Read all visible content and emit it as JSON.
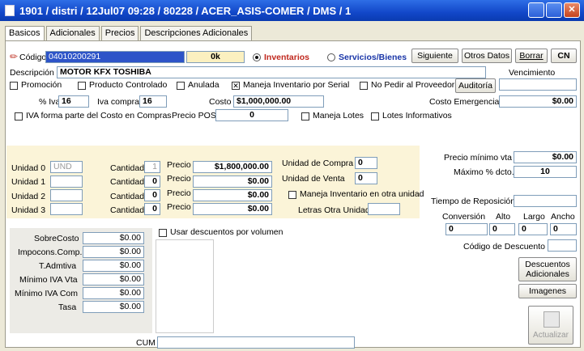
{
  "window": {
    "title": "1901 / distri / 12Jul07 09:28 / 80228 / ACER_ASIS-COMER / DMS / 1"
  },
  "tabs": [
    "Basicos",
    "Adicionales",
    "Precios",
    "Descripciones Adicionales"
  ],
  "header": {
    "codigo_label": "Código",
    "codigo_value": "04010200291",
    "ok_label": "0k",
    "inventarios_label": "Inventarios",
    "servicios_label": "Servicios/Bienes",
    "siguiente": "Siguiente",
    "otros_datos": "Otros Datos",
    "borrar": "Borrar",
    "cn": "CN",
    "descripcion_label": "Descripción",
    "descripcion_value": "MOTOR KFX TOSHIBA",
    "vencimiento_label": "Vencimiento",
    "auditoria": "Auditoría"
  },
  "flags": {
    "promocion": "Promoción",
    "controlado": "Producto Controlado",
    "anulada": "Anulada",
    "serial": "Maneja Inventario por Serial",
    "no_pedir": "No Pedir al Proveedor",
    "iva_costo": "IVA forma parte del Costo en Compras",
    "maneja_lotes": "Maneja Lotes",
    "lotes_info": "Lotes Informativos",
    "otra_unidad": "Maneja Inventario en otra unidad",
    "usar_desc": "Usar descuentos por volumen"
  },
  "tax": {
    "iva_label": "% Iva",
    "iva_value": "16",
    "iva_compra_label": "Iva compra",
    "iva_compra_value": "16",
    "costo_label": "Costo",
    "costo_value": "$1,000,000.00",
    "costo_emerg_label": "Costo Emergencia",
    "costo_emerg_value": "$0.00",
    "precio_pos_label": "Precio POS",
    "precio_pos_value": "0"
  },
  "units": [
    {
      "label": "Unidad 0",
      "unit": "UND",
      "qty": "1",
      "price": "$1,800,000.00"
    },
    {
      "label": "Unidad 1",
      "unit": "",
      "qty": "0",
      "price": "$0.00"
    },
    {
      "label": "Unidad 2",
      "unit": "",
      "qty": "0",
      "price": "$0.00"
    },
    {
      "label": "Unidad 3",
      "unit": "",
      "qty": "0",
      "price": "$0.00"
    }
  ],
  "unit_labels": {
    "cantidad": "Cantidad",
    "precio": "Precio",
    "unidad_compra": "Unidad de Compra",
    "unidad_compra_value": "0",
    "unidad_venta": "Unidad de Venta",
    "unidad_venta_value": "0",
    "letras": "Letras Otra Unidad"
  },
  "right": {
    "precio_min_label": "Precio mínimo vta",
    "precio_min_value": "$0.00",
    "max_dcto_label": "Máximo % dcto.",
    "max_dcto_value": "10",
    "tiempo_label": "Tiempo de Reposición",
    "conversion": "Conversión",
    "alto": "Alto",
    "largo": "Largo",
    "ancho": "Ancho",
    "conv_vals": [
      "0",
      "0",
      "0",
      "0"
    ],
    "cod_desc_label": "Código de Descuento",
    "desc_adic": "Descuentos Adicionales",
    "imagenes": "Imagenes",
    "actualizar": "Actualizar"
  },
  "costs": [
    {
      "label": "SobreCosto",
      "value": "$0.00"
    },
    {
      "label": "Impocons.Comp.",
      "value": "$0.00"
    },
    {
      "label": "T.Admtiva",
      "value": "$0.00"
    },
    {
      "label": "Mínimo IVA Vta",
      "value": "$0.00"
    },
    {
      "label": "Mínimo IVA Com",
      "value": "$0.00"
    },
    {
      "label": "Tasa",
      "value": "$0.00"
    }
  ],
  "cum_label": "CUM"
}
